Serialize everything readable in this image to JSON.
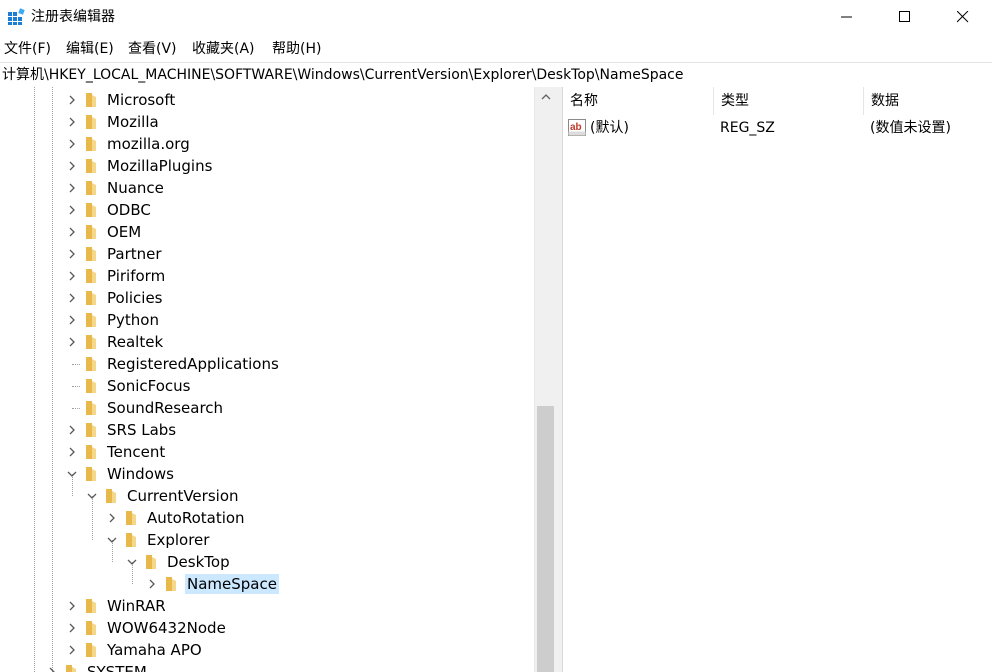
{
  "window": {
    "title": "注册表编辑器"
  },
  "menu": [
    {
      "label": "文件(F)"
    },
    {
      "label": "编辑(E)"
    },
    {
      "label": "查看(V)"
    },
    {
      "label": "收藏夹(A)"
    },
    {
      "label": "帮助(H)"
    }
  ],
  "address": {
    "path": "计算机\\HKEY_LOCAL_MACHINE\\SOFTWARE\\Windows\\CurrentVersion\\Explorer\\DeskTop\\NameSpace"
  },
  "tree": {
    "items": [
      {
        "label": "Microsoft",
        "depth": 0,
        "expander": "collapsed"
      },
      {
        "label": "Mozilla",
        "depth": 0,
        "expander": "collapsed"
      },
      {
        "label": "mozilla.org",
        "depth": 0,
        "expander": "collapsed"
      },
      {
        "label": "MozillaPlugins",
        "depth": 0,
        "expander": "collapsed"
      },
      {
        "label": "Nuance",
        "depth": 0,
        "expander": "collapsed"
      },
      {
        "label": "ODBC",
        "depth": 0,
        "expander": "collapsed"
      },
      {
        "label": "OEM",
        "depth": 0,
        "expander": "collapsed"
      },
      {
        "label": "Partner",
        "depth": 0,
        "expander": "collapsed"
      },
      {
        "label": "Piriform",
        "depth": 0,
        "expander": "collapsed"
      },
      {
        "label": "Policies",
        "depth": 0,
        "expander": "collapsed"
      },
      {
        "label": "Python",
        "depth": 0,
        "expander": "collapsed"
      },
      {
        "label": "Realtek",
        "depth": 0,
        "expander": "collapsed"
      },
      {
        "label": "RegisteredApplications",
        "depth": 0,
        "expander": "none"
      },
      {
        "label": "SonicFocus",
        "depth": 0,
        "expander": "none"
      },
      {
        "label": "SoundResearch",
        "depth": 0,
        "expander": "none"
      },
      {
        "label": "SRS Labs",
        "depth": 0,
        "expander": "collapsed"
      },
      {
        "label": "Tencent",
        "depth": 0,
        "expander": "collapsed"
      },
      {
        "label": "Windows",
        "depth": 0,
        "expander": "expanded"
      },
      {
        "label": "CurrentVersion",
        "depth": 1,
        "expander": "expanded"
      },
      {
        "label": "AutoRotation",
        "depth": 2,
        "expander": "collapsed"
      },
      {
        "label": "Explorer",
        "depth": 2,
        "expander": "expanded"
      },
      {
        "label": "DeskTop",
        "depth": 3,
        "expander": "expanded"
      },
      {
        "label": "NameSpace",
        "depth": 4,
        "expander": "collapsed",
        "selected": true
      },
      {
        "label": "WinRAR",
        "depth": 0,
        "expander": "collapsed"
      },
      {
        "label": "WOW6432Node",
        "depth": 0,
        "expander": "collapsed"
      },
      {
        "label": "Yamaha APO",
        "depth": 0,
        "expander": "collapsed"
      },
      {
        "label": "SYSTEM",
        "depth": -1,
        "expander": "collapsed"
      }
    ]
  },
  "scrollbar": {
    "thumb_position": 0.53,
    "thumb_size": 0.47
  },
  "values": {
    "columns": [
      {
        "label": "名称"
      },
      {
        "label": "类型"
      },
      {
        "label": "数据"
      }
    ],
    "rows": [
      {
        "name": "(默认)",
        "type": "REG_SZ",
        "data": "(数值未设置)",
        "icon": "string-value-icon"
      }
    ]
  },
  "colors": {
    "selection": "#cce8ff",
    "folder": "#e8b84a",
    "scroll_track": "#f0f0f0",
    "scroll_thumb": "#cdcdcd"
  }
}
